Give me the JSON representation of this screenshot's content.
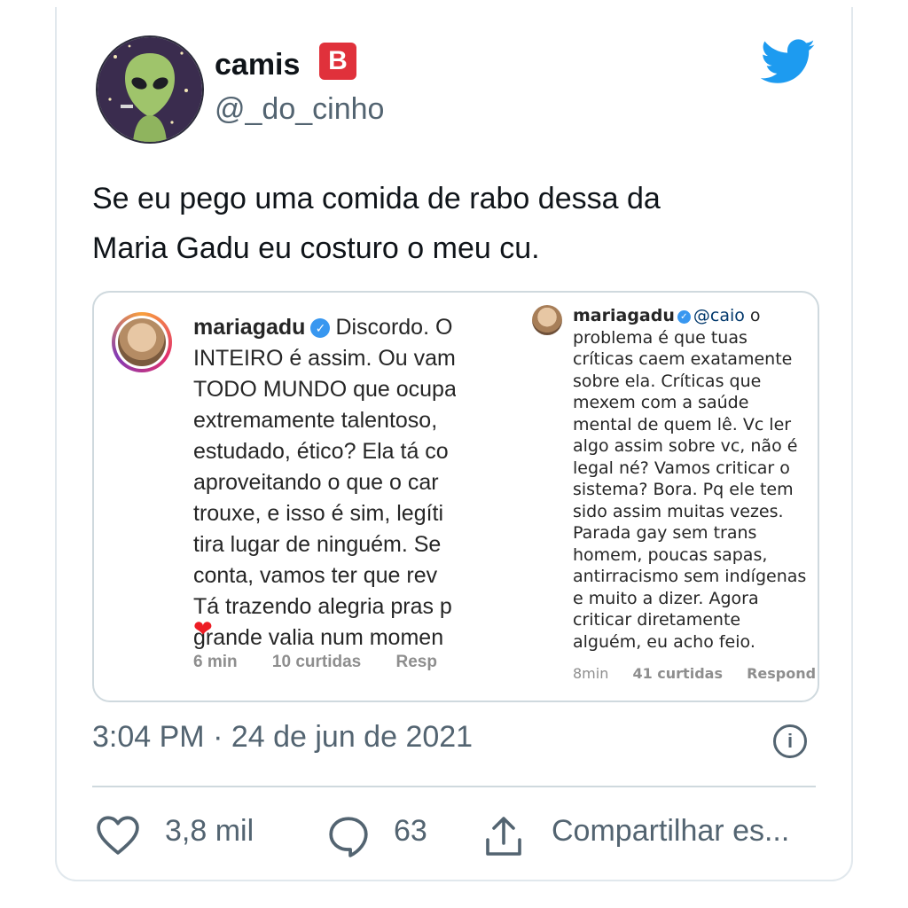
{
  "tweet": {
    "display_name": "camis",
    "badge_letter": "B",
    "handle": "@_do_cinho",
    "text_line1": "Se eu pego uma comida de rabo dessa da",
    "text_line2": "Maria Gadu eu costuro o meu cu.",
    "timestamp": "3:04 PM · 24 de jun de 2021",
    "actions": {
      "likes": "3,8 mil",
      "replies": "63",
      "share_label": "Compartilhar es..."
    },
    "colors": {
      "twitter_blue": "#1d9bf0",
      "badge_red": "#e0313b",
      "muted": "#536471"
    }
  },
  "embed": {
    "left_comment": {
      "username": "mariagadu",
      "lines": [
        "Discordo. O",
        "INTEIRO é assim. Ou vam",
        "TODO MUNDO que ocupa",
        "extremamente talentoso,",
        "estudado, ético? Ela tá co",
        "aproveitando o que o car",
        "trouxe, e isso é sim, legíti",
        "tira lugar de ninguém. Se",
        "conta, vamos ter que rev",
        "Tá trazendo alegria pras p",
        "grande valia num momen"
      ],
      "emoji": "❤",
      "time": "6 min",
      "likes": "10 curtidas",
      "reply": "Resp"
    },
    "right_comment": {
      "username": "mariagadu",
      "mention": "@caio",
      "first_word": "o",
      "lines": [
        "problema é que tuas",
        "críticas caem exatamente",
        "sobre ela. Críticas que",
        "mexem com a saúde",
        "mental de quem lê. Vc ler",
        "algo assim sobre vc, não é",
        "legal né? Vamos criticar o",
        "sistema? Bora. Pq ele tem",
        "sido assim muitas vezes.",
        "Parada gay sem trans",
        "homem, poucas sapas,",
        "antirracismo sem indígenas",
        "e muito a dizer. Agora",
        "criticar diretamente",
        "alguém, eu acho feio."
      ],
      "time": "8min",
      "likes": "41 curtidas",
      "reply": "Respond"
    }
  },
  "icons": [
    "twitter-bird-icon",
    "verified-icon",
    "heart-icon",
    "reply-bubble-icon",
    "share-icon",
    "info-icon"
  ]
}
